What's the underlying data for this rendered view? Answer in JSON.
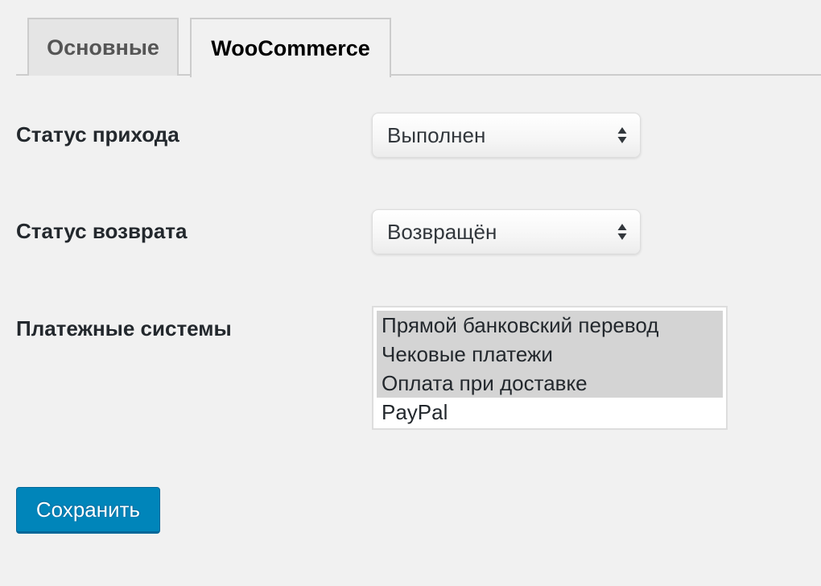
{
  "tabs": [
    {
      "label": "Основные",
      "active": false
    },
    {
      "label": "WooCommerce",
      "active": true
    }
  ],
  "form": {
    "income_status": {
      "label": "Статус прихода",
      "value": "Выполнен"
    },
    "refund_status": {
      "label": "Статус возврата",
      "value": "Возвращён"
    },
    "payment_systems": {
      "label": "Платежные системы",
      "options": [
        {
          "label": "Прямой банковский перевод",
          "selected": true
        },
        {
          "label": "Чековые платежи",
          "selected": true
        },
        {
          "label": "Оплата при доставке",
          "selected": true
        },
        {
          "label": "PayPal",
          "selected": false
        }
      ]
    }
  },
  "save_label": "Сохранить",
  "colors": {
    "background": "#f1f1f1",
    "primary_button": "#0085ba",
    "selected_option": "#d4d4d4"
  },
  "icons": {
    "select_arrows": "up-down-arrows-icon"
  }
}
